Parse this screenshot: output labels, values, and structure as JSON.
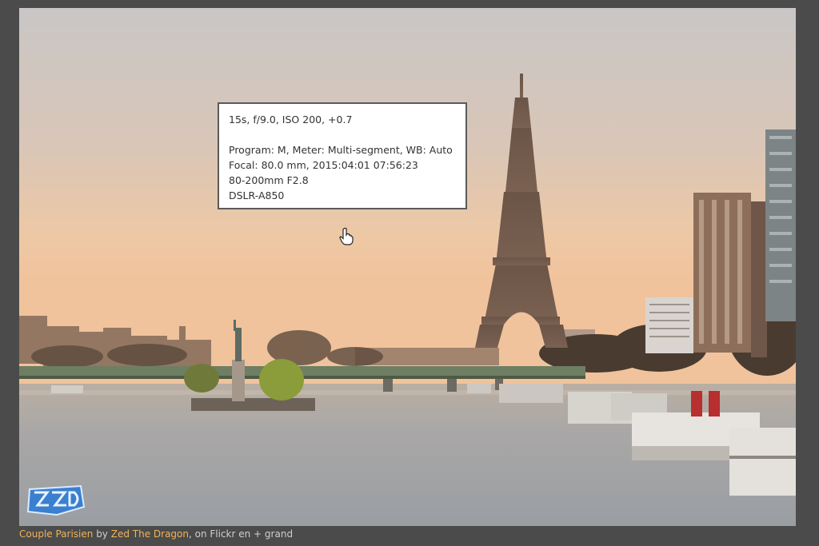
{
  "photo": {
    "description_icon": "eiffel-tower-photo"
  },
  "exif": {
    "line1": "15s, f/9.0, ISO 200, +0.7",
    "line2": "Program: M, Meter: Multi-segment, WB: Auto",
    "line3": "Focal: 80.0 mm, 2015:04:01 07:56:23",
    "line4": "80-200mm F2.8",
    "line5": "DSLR-A850"
  },
  "caption": {
    "title": "Couple Parisien",
    "by": " by ",
    "author": "Zed The Dragon",
    "suffix": ", on Flickr en + grand"
  },
  "colors": {
    "frame_bg": "#4b4b4b",
    "link": "#f0b35a",
    "caption_text": "#cfcfcf"
  }
}
